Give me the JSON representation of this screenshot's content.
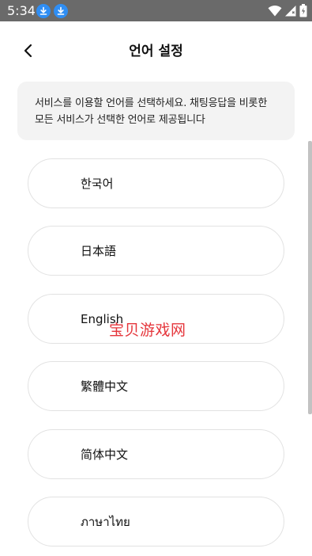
{
  "status_bar": {
    "time": "5:34",
    "notification_icons": [
      "download-icon",
      "download-icon"
    ],
    "system_icons": [
      "wifi-icon",
      "cellular-signal-icon",
      "battery-icon"
    ]
  },
  "header": {
    "title": "언어 설정",
    "back_icon": "chevron-left-icon"
  },
  "info": {
    "text": "서비스를 이용할 언어를 선택하세요. 채팅응답을 비롯한 모든 서비스가 선택한 언어로 제공됩니다"
  },
  "languages": [
    {
      "label": "한국어"
    },
    {
      "label": "日本語"
    },
    {
      "label": "English"
    },
    {
      "label": "繁體中文"
    },
    {
      "label": "简体中文"
    },
    {
      "label": "ภาษาไทย"
    }
  ],
  "watermark": "宝贝游戏网",
  "colors": {
    "status_bar_bg": "#6a6a6a",
    "download_badge": "#2f8ef4",
    "info_box_bg": "#f3f3f3",
    "item_border": "#e2e2e2",
    "watermark": "#e5353b",
    "scrollbar": "#c2c2c2"
  }
}
